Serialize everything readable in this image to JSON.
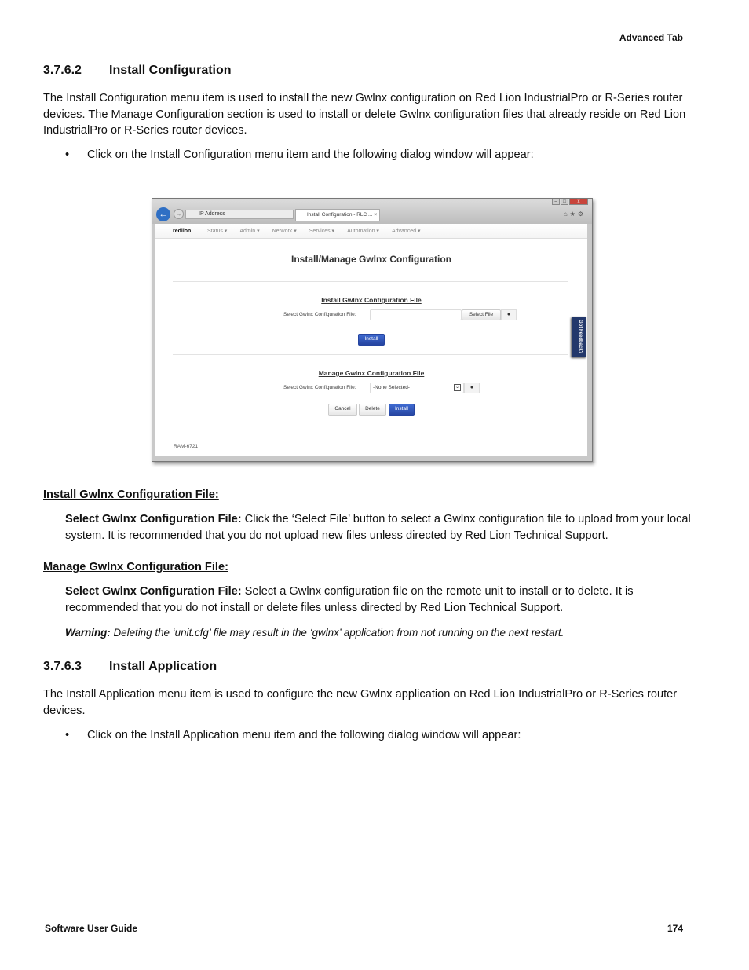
{
  "header": {
    "section": "Advanced Tab"
  },
  "s1": {
    "num": "3.7.6.2",
    "title": "Install Configuration",
    "intro": "The Install Configuration menu item is used to install the new Gwlnx configuration on Red Lion IndustrialPro or R-Series router devices. The Manage Configuration section is used to install or delete Gwlnx configuration files that already reside on Red Lion IndustrialPro or R-Series router devices.",
    "bullet": "Click on the Install Configuration menu item and the following dialog window will appear:"
  },
  "shot": {
    "address": "IP Address",
    "tab": "Install Configuration - RLC ...",
    "tab_close": "×",
    "logo": "redlion",
    "menu": [
      "Status ▾",
      "Admin ▾",
      "Network ▾",
      "Services ▾",
      "Automation ▾",
      "Advanced ▾"
    ],
    "title": "Install/Manage Gwlnx Configuration",
    "install_section": "Install Gwlnx Configuration File",
    "select_label": "Select Gwlnx Configuration File:",
    "select_file": "Select File",
    "install": "Install",
    "manage_section": "Manage Gwlnx Configuration File",
    "none_selected": "-None Selected-",
    "cancel": "Cancel",
    "delete": "Delete",
    "feedback": "Got Feedback?",
    "footer": "RAM-6721"
  },
  "install_file": {
    "heading": "Install Gwlnx Configuration File:",
    "term": "Select Gwlnx Configuration File:",
    "text": " Click the ‘Select File’ button to select a Gwlnx configuration file to upload from your local system. It is recommended that you do not upload new files unless directed by Red Lion Technical Support."
  },
  "manage_file": {
    "heading": "Manage Gwlnx Configuration File:",
    "term": "Select Gwlnx Configuration File:",
    "text": " Select a Gwlnx configuration file on the remote unit to install or to delete. It is recommended that you do not install or delete files unless directed by Red Lion Technical Support.",
    "warning_label": "Warning:",
    "warning": " Deleting the ‘unit.cfg’ file may result in the ‘gwlnx’ application from not running on the next restart."
  },
  "s2": {
    "num": "3.7.6.3",
    "title": "Install Application",
    "intro": "The Install Application menu item is used to configure the new Gwlnx application on Red Lion IndustrialPro or R-Series router devices.",
    "bullet": "Click on the Install Application menu item and the following dialog window will appear:"
  },
  "footer": {
    "left": "Software User Guide",
    "page": "174"
  }
}
